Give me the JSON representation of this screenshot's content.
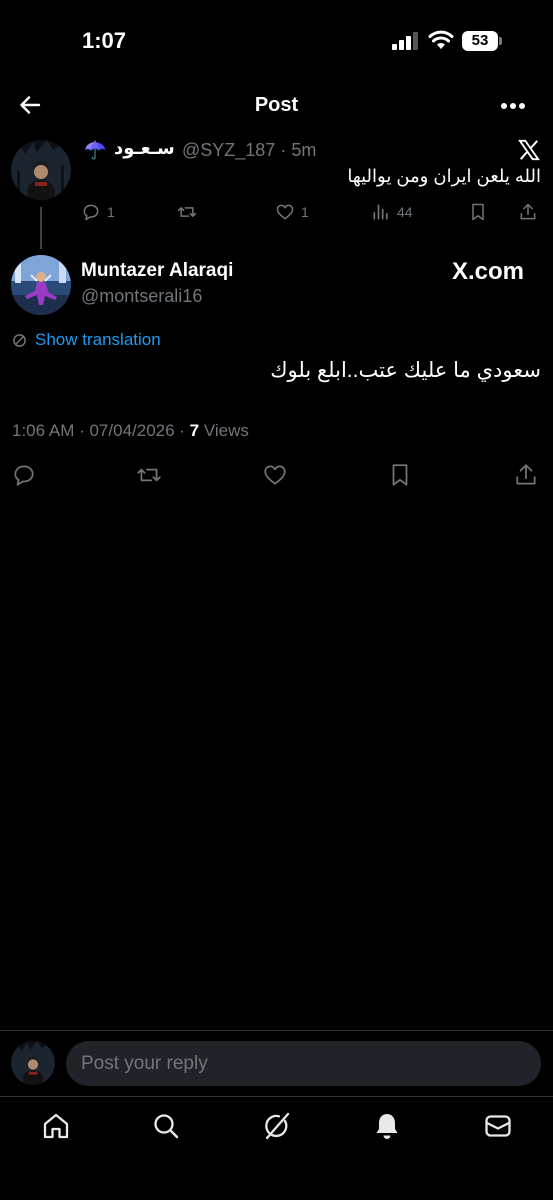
{
  "status_bar": {
    "time": "1:07",
    "battery": "53"
  },
  "header": {
    "title": "Post",
    "back_icon": "arrow-left-icon",
    "more_icon": "more-horizontal-icon"
  },
  "parent_post": {
    "name": "سـعـود",
    "emoji": "☂️",
    "handle": "@SYZ_187 · 5m",
    "text": "الله يلعن ايران ومن يواليها",
    "replies": "1",
    "likes": "1",
    "views": "44"
  },
  "main_post": {
    "name": "Muntazer Alaraqi",
    "handle": "@montserali16",
    "watermark": "X.com",
    "show_translation": "Show translation",
    "text": "سعودي ما عليك عتب..ابلع بلوك",
    "timestamp": "1:06 AM · 07/04/2026 · ",
    "views_count": "7",
    "views_label": " Views"
  },
  "reply_bar": {
    "placeholder": "Post your reply"
  },
  "bottom_nav": {
    "items": [
      "home-icon",
      "search-icon",
      "grok-icon",
      "notifications-icon",
      "messages-icon"
    ]
  },
  "colors": {
    "background": "#000000",
    "accent": "#1d9bf0",
    "muted": "#71767b",
    "text": "#e7e9ea"
  }
}
